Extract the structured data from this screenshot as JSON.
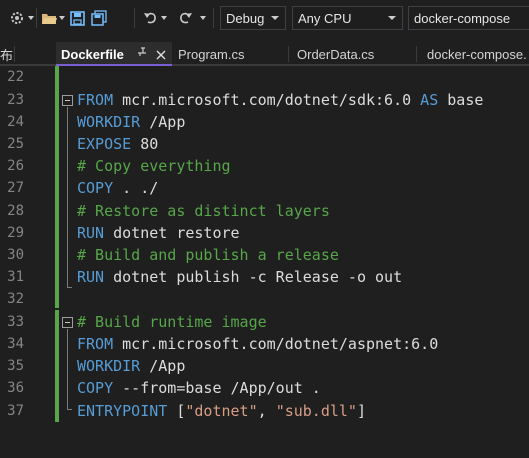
{
  "toolbar": {
    "icons": [
      "gear-icon",
      "open-folder-icon",
      "save-icon",
      "save-all-icon",
      "undo-icon",
      "redo-icon"
    ],
    "configuration": "Debug",
    "platform": "Any CPU",
    "startup_project": "docker-compose"
  },
  "tabs": [
    {
      "label": "布"
    },
    {
      "label": "Dockerfile",
      "active": true
    },
    {
      "label": "Program.cs"
    },
    {
      "label": "OrderData.cs"
    },
    {
      "label": "docker-compose."
    }
  ],
  "editor": {
    "line_numbers": [
      "22",
      "23",
      "24",
      "25",
      "26",
      "27",
      "28",
      "29",
      "30",
      "31",
      "32",
      "33",
      "34",
      "35",
      "36",
      "37"
    ],
    "lines": [
      {
        "num": "23",
        "kw": "FROM",
        "rest": " mcr.microsoft.com/dotnet/sdk:6.0 ",
        "kw2": "AS",
        "rest2": " base"
      },
      {
        "num": "24",
        "kw": "WORKDIR",
        "rest": " /App"
      },
      {
        "num": "25",
        "kw": "EXPOSE",
        "rest": " 80"
      },
      {
        "num": "26",
        "comment": "# Copy everything"
      },
      {
        "num": "27",
        "kw": "COPY",
        "rest": " . ./"
      },
      {
        "num": "28",
        "comment": "# Restore as distinct layers"
      },
      {
        "num": "29",
        "kw": "RUN",
        "rest": " dotnet restore"
      },
      {
        "num": "30",
        "comment": "# Build and publish a release"
      },
      {
        "num": "31",
        "kw": "RUN",
        "rest": " dotnet publish -c Release -o out"
      },
      {
        "num": "33",
        "comment": "# Build runtime image"
      },
      {
        "num": "34",
        "kw": "FROM",
        "rest": " mcr.microsoft.com/dotnet/aspnet:6.0"
      },
      {
        "num": "35",
        "kw": "WORKDIR",
        "rest": " /App"
      },
      {
        "num": "36",
        "kw": "COPY",
        "rest": " --from=base /App/out ."
      },
      {
        "num": "37",
        "kw": "ENTRYPOINT",
        "rest": " [",
        "str1": "\"dotnet\"",
        "rest2": ", ",
        "str2": "\"sub.dll\"",
        "rest3": "]"
      }
    ]
  },
  "colors": {
    "keyword": "#569cd6",
    "comment": "#57a64a",
    "string": "#d69d85",
    "change_bar": "#57a64a",
    "active_tab_accent": "#7a5fd0"
  }
}
